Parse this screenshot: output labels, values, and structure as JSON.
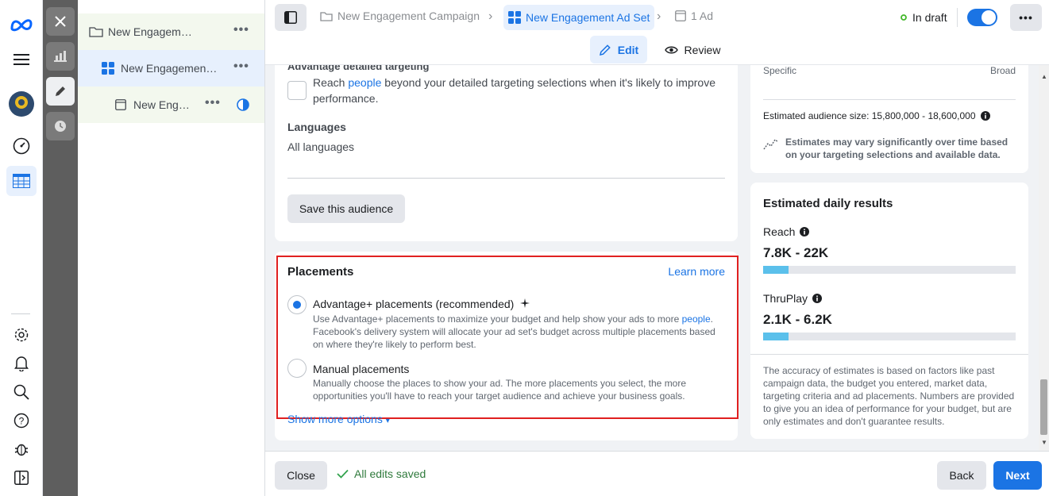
{
  "breadcrumb": {
    "campaign": "New Engagement Campaign",
    "adset": "New Engagement Ad Set",
    "ad": "1 Ad"
  },
  "status": {
    "label": "In draft"
  },
  "mode_tabs": {
    "edit": "Edit",
    "review": "Review"
  },
  "tree": {
    "campaign": "New Engagement Campaign",
    "adset": "New Engagement Ad Set",
    "ad": "New Engagement Ad"
  },
  "audience": {
    "cut_heading": "Advantage detailed targeting",
    "expand_text_pre": "Reach",
    "expand_link": "people",
    "expand_text_post": "beyond your detailed targeting selections when it's likely to improve performance.",
    "languages_label": "Languages",
    "languages_value": "All languages",
    "save_button": "Save this audience"
  },
  "placements": {
    "title": "Placements",
    "learn_more": "Learn more",
    "options": [
      {
        "label": "Advantage+ placements (recommended)",
        "desc_pre": "Use Advantage+ placements to maximize your budget and help show your ads to more",
        "desc_link": "people",
        "desc_post": ". Facebook's delivery system will allocate your ad set's budget across multiple placements based on where they're likely to perform best.",
        "selected": true
      },
      {
        "label": "Manual placements",
        "desc": "Manually choose the places to show your ad. The more placements you select, the more opportunities you'll have to reach your target audience and achieve your business goals.",
        "selected": false
      }
    ],
    "show_more": "Show more options"
  },
  "audience_size": {
    "specific": "Specific",
    "broad": "Broad",
    "estimate": "Estimated audience size: 15,800,000 - 18,600,000",
    "note": "Estimates may vary significantly over time based on your targeting selections and available data."
  },
  "daily_results": {
    "title": "Estimated daily results",
    "reach_label": "Reach",
    "reach_value": "7.8K - 22K",
    "reach_fill": 0.1,
    "thruplay_label": "ThruPlay",
    "thruplay_value": "2.1K - 6.2K",
    "thruplay_fill": 0.1,
    "disclaimer": "The accuracy of estimates is based on factors like past campaign data, the budget you entered, market data, targeting criteria and ad placements. Numbers are provided to give you an idea of performance for your budget, but are only estimates and don't guarantee results."
  },
  "footer": {
    "close": "Close",
    "saved": "All edits saved",
    "back": "Back",
    "next": "Next"
  },
  "colors": {
    "accent": "#1b74e4",
    "highlight": "#e02020",
    "draft": "#42b72a"
  }
}
